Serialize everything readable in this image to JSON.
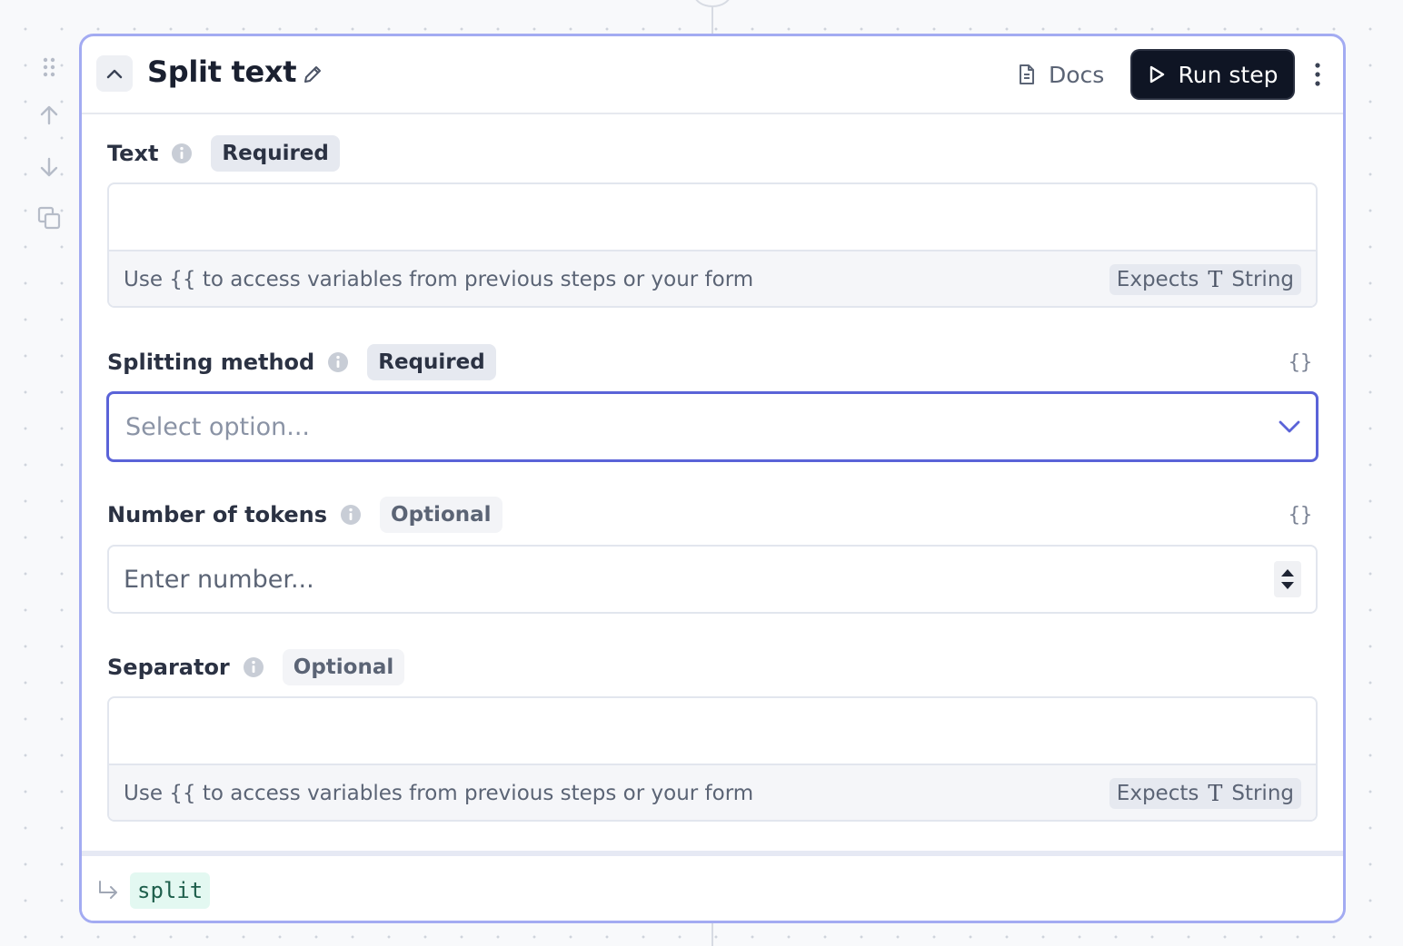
{
  "step": {
    "title": "Split text",
    "docs_label": "Docs",
    "run_label": "Run step"
  },
  "fields": {
    "text": {
      "label": "Text",
      "badge": "Required",
      "helper": "Use {{ to access variables from previous steps or your form",
      "expects_label": "Expects",
      "type_glyph": "T",
      "type_name": "String"
    },
    "splitting_method": {
      "label": "Splitting method",
      "badge": "Required",
      "braces": "{}",
      "placeholder": "Select option..."
    },
    "number_of_tokens": {
      "label": "Number of tokens",
      "badge": "Optional",
      "braces": "{}",
      "placeholder": "Enter number..."
    },
    "separator": {
      "label": "Separator",
      "badge": "Optional",
      "helper": "Use {{ to access variables from previous steps or your form",
      "expects_label": "Expects",
      "type_glyph": "T",
      "type_name": "String"
    }
  },
  "output": {
    "variable": "split"
  },
  "icons": {
    "drag_handle": "drag-handle-icon",
    "move_up": "arrow-up-icon",
    "move_down": "arrow-down-icon",
    "duplicate": "duplicate-icon",
    "collapse": "chevron-up-icon",
    "edit": "pencil-icon",
    "docs": "document-icon",
    "run": "play-icon",
    "more": "more-vertical-icon",
    "info": "info-icon",
    "dropdown": "chevron-down-icon",
    "output": "return-arrow-icon"
  },
  "colors": {
    "card_border": "#a3abf2",
    "focus_border": "#5a63d8",
    "run_button_bg": "#0f1524",
    "output_var_bg": "#e3f8f1"
  }
}
